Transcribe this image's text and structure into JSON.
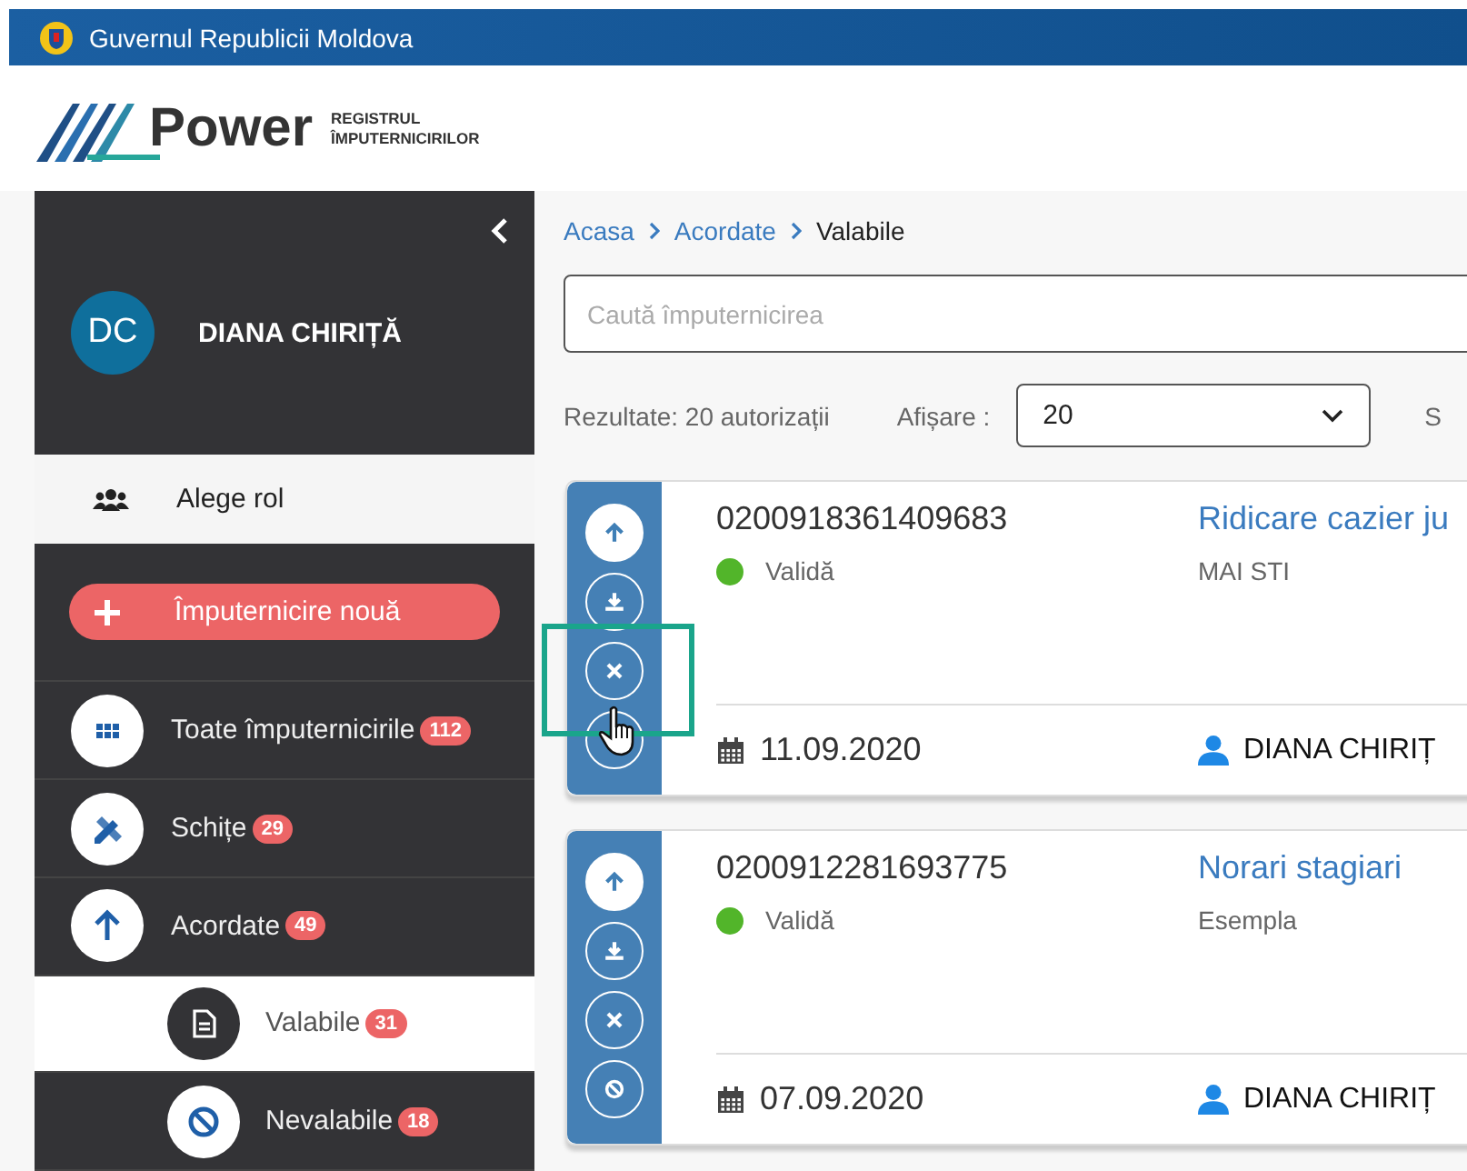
{
  "gov_bar": {
    "title": "Guvernul Republicii Moldova"
  },
  "logo": {
    "name": "Power",
    "subtitle_1": "REGISTRUL",
    "subtitle_2": "ÎMPUTERNICIRILOR"
  },
  "sidebar": {
    "user": {
      "initials": "DC",
      "name": "DIANA CHIRIȚĂ"
    },
    "role_label": "Alege rol",
    "new_button": "Împuternicire nouă",
    "items": [
      {
        "label": "Toate împuternicirile",
        "count": "112",
        "selected": false
      },
      {
        "label": "Schițe",
        "count": "29",
        "selected": false
      },
      {
        "label": "Acordate",
        "count": "49",
        "selected": false,
        "children": [
          {
            "label": "Valabile",
            "count": "31",
            "selected": true
          },
          {
            "label": "Nevalabile",
            "count": "18",
            "selected": false
          }
        ]
      }
    ]
  },
  "breadcrumb": [
    "Acasa",
    "Acordate",
    "Valabile"
  ],
  "search": {
    "placeholder": "Caută împuternicirea"
  },
  "results": {
    "summary": "Rezultate: 20 autorizații",
    "display_label": "Afișare :",
    "display_value": "20",
    "column_3": "S"
  },
  "cards": [
    {
      "number": "0200918361409683",
      "status": "Validă",
      "color": "#52b52a",
      "title": "Ridicare cazier ju",
      "subtitle": "MAI STI",
      "date": "11.09.2020",
      "person": "DIANA CHIRIȚ",
      "highlighted": true
    },
    {
      "number": "0200912281693775",
      "status": "Validă",
      "color": "#52b52a",
      "title": "Norari stagiari",
      "subtitle": "Esempla",
      "date": "07.09.2020",
      "person": "DIANA CHIRIȚ",
      "highlighted": false
    }
  ]
}
